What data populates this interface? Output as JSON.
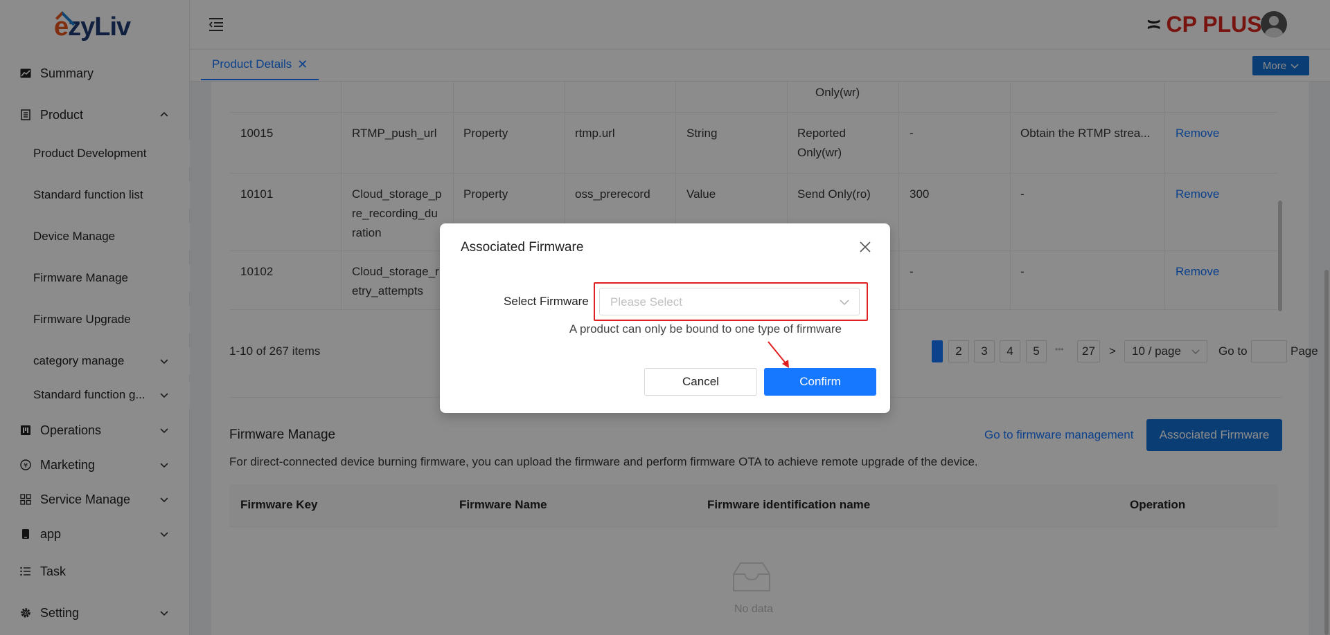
{
  "app": {
    "logo_e": "e",
    "logo_rest": "zyLiv",
    "brand": "CP PLUS",
    "brand_mark": "≍"
  },
  "colors": {
    "accent": "#1677ff",
    "primary_button": "#1570d6",
    "highlight": "#e02020",
    "brand": "#d9261c",
    "logo_orange": "#e8541e",
    "logo_navy": "#1f3b73"
  },
  "sidebar": {
    "items": [
      {
        "label": "Summary",
        "icon": "chart-icon"
      },
      {
        "label": "Product",
        "icon": "product-icon",
        "expanded": true
      },
      {
        "label": "Product Development"
      },
      {
        "label": "Standard function list"
      },
      {
        "label": "Device Manage"
      },
      {
        "label": "Firmware Manage"
      },
      {
        "label": "Firmware Upgrade"
      },
      {
        "label": "category manage"
      },
      {
        "label": "Standard function g..."
      },
      {
        "label": "Operations",
        "icon": "operations-icon"
      },
      {
        "label": "Marketing",
        "icon": "yen-icon"
      },
      {
        "label": "Service Manage",
        "icon": "grid-icon"
      },
      {
        "label": "app",
        "icon": "phone-icon"
      },
      {
        "label": "Task",
        "icon": "list-icon"
      },
      {
        "label": "Setting",
        "icon": "gear-icon"
      }
    ]
  },
  "tabs": {
    "active": "Product Details",
    "close": "✕",
    "more": "More"
  },
  "function_table": {
    "rows": [
      {
        "c5": "Only(wr)"
      },
      {
        "c0": "10015",
        "c1": "RTMP_push_url",
        "c2": "Property",
        "c3": "rtmp.url",
        "c4": "String",
        "c5a": "Reported",
        "c5b": "Only(wr)",
        "c6": "-",
        "c7": "Obtain the RTMP strea...",
        "action": "Remove"
      },
      {
        "c0": "10101",
        "c1a": "Cloud_storage_p",
        "c1b": "re_recording_du",
        "c1c": "ration",
        "c2": "Property",
        "c3": "oss_prerecord",
        "c4": "Value",
        "c5": "Send Only(ro)",
        "c6": "300",
        "c7": "-",
        "action": "Remove"
      },
      {
        "c0": "10102",
        "c1a": "Cloud_storage_r",
        "c1b": "etry_attempts",
        "c6": "-",
        "c7": "-",
        "action": "Remove"
      }
    ]
  },
  "pagination": {
    "summary": "1-10 of 267 items",
    "pages": [
      "2",
      "3",
      "4",
      "5"
    ],
    "ellipsis": "•••",
    "last": "27",
    "next": ">",
    "page_size": "10 / page",
    "goto": "Go to",
    "page": "Page"
  },
  "firmware": {
    "title": "Firmware Manage",
    "link": "Go to firmware management",
    "button": "Associated Firmware",
    "description": "For direct-connected device burning firmware, you can upload the firmware and perform firmware OTA to achieve remote upgrade of the device.",
    "columns": [
      "Firmware Key",
      "Firmware Name",
      "Firmware identification name",
      "Operation"
    ],
    "empty": "No data"
  },
  "modal": {
    "title": "Associated Firmware",
    "field_label": "Select Firmware",
    "placeholder": "Please Select",
    "hint": "A product can only be bound to one type of firmware",
    "cancel": "Cancel",
    "confirm": "Confirm"
  }
}
